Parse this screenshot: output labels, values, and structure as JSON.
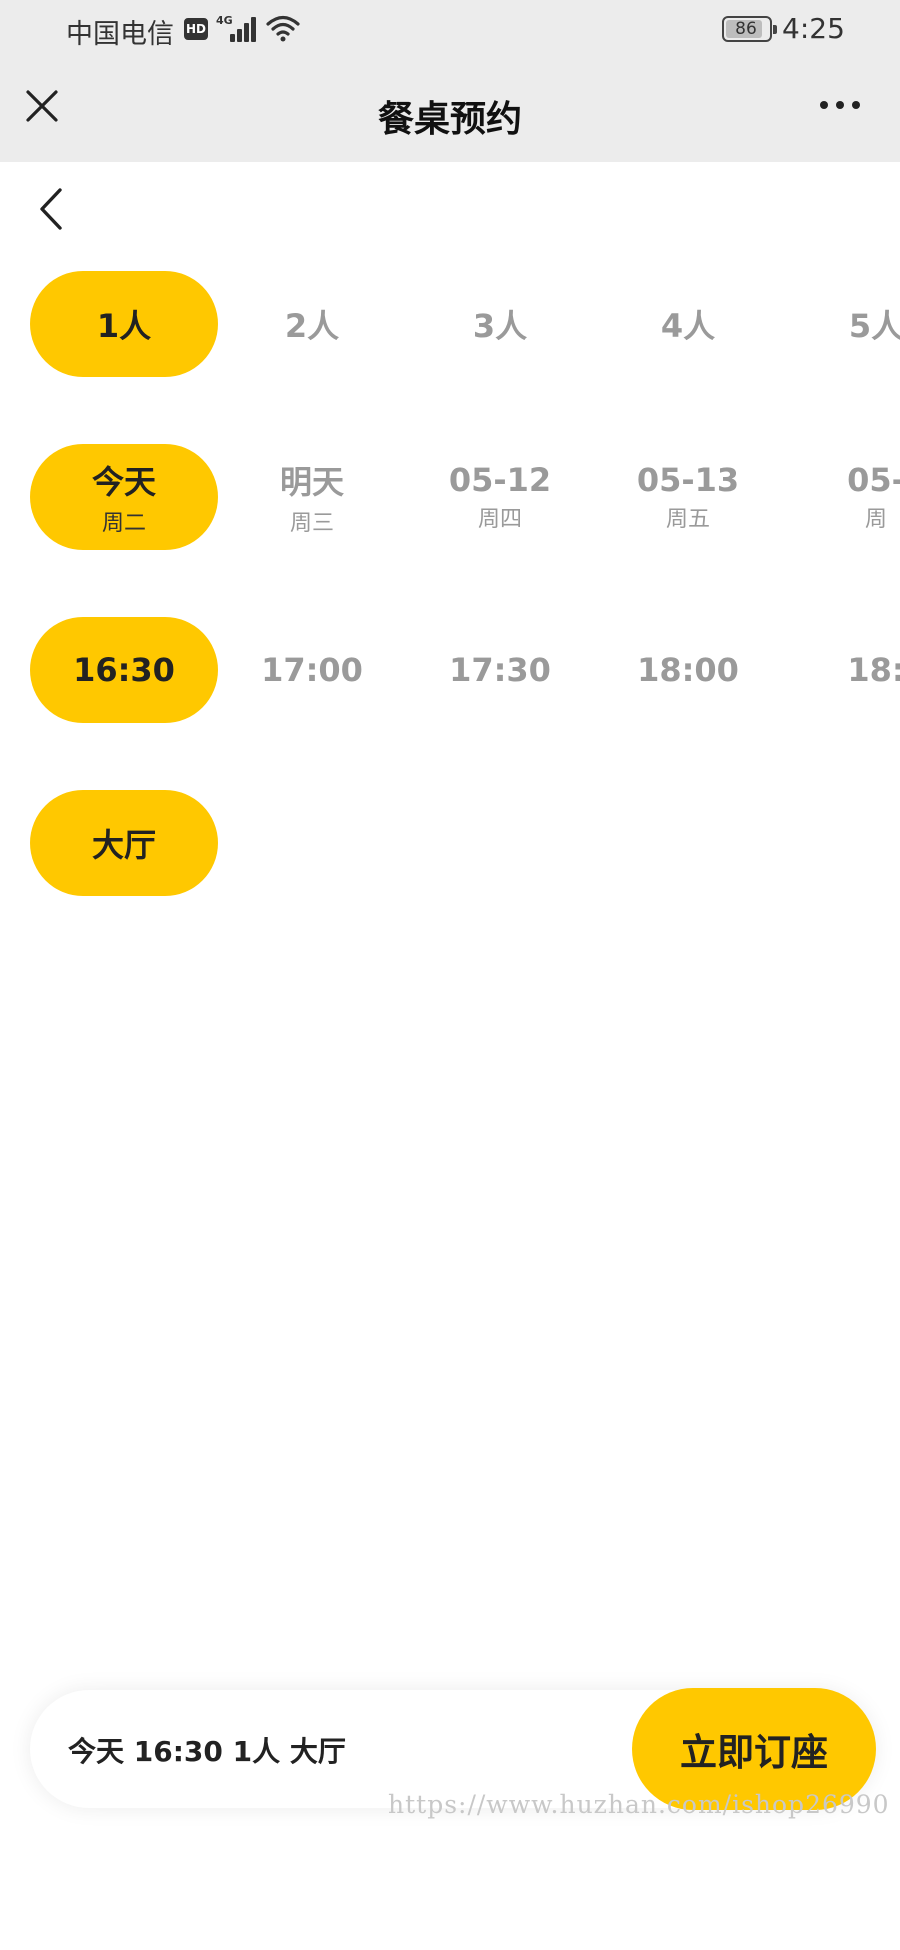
{
  "status_bar": {
    "carrier": "中国电信",
    "hd": "HD",
    "network": "4G",
    "battery": "86",
    "time": "4:25"
  },
  "header": {
    "title": "餐桌预约",
    "close_icon": "close-icon",
    "more_icon": "more-icon"
  },
  "back_icon": "chevron-left-icon",
  "people": [
    {
      "label": "1人",
      "selected": true
    },
    {
      "label": "2人",
      "selected": false
    },
    {
      "label": "3人",
      "selected": false
    },
    {
      "label": "4人",
      "selected": false
    },
    {
      "label": "5人",
      "selected": false
    }
  ],
  "dates": [
    {
      "day": "今天",
      "weekday": "周二",
      "selected": true
    },
    {
      "day": "明天",
      "weekday": "周三",
      "selected": false
    },
    {
      "day": "05-12",
      "weekday": "周四",
      "selected": false
    },
    {
      "day": "05-13",
      "weekday": "周五",
      "selected": false
    },
    {
      "day": "05-",
      "weekday": "周",
      "selected": false
    }
  ],
  "times": [
    {
      "label": "16:30",
      "selected": true
    },
    {
      "label": "17:00",
      "selected": false
    },
    {
      "label": "17:30",
      "selected": false
    },
    {
      "label": "18:00",
      "selected": false
    },
    {
      "label": "18:",
      "selected": false
    }
  ],
  "areas": [
    {
      "label": "大厅",
      "selected": true
    }
  ],
  "bottom": {
    "summary": "今天 16:30 1人 大厅",
    "book_label": "立即订座"
  },
  "watermark": "https://www.huzhan.com/ishop26990",
  "colors": {
    "accent": "#ffc800",
    "header_bg": "#ececec",
    "unselected_text": "#9a9a9a"
  }
}
